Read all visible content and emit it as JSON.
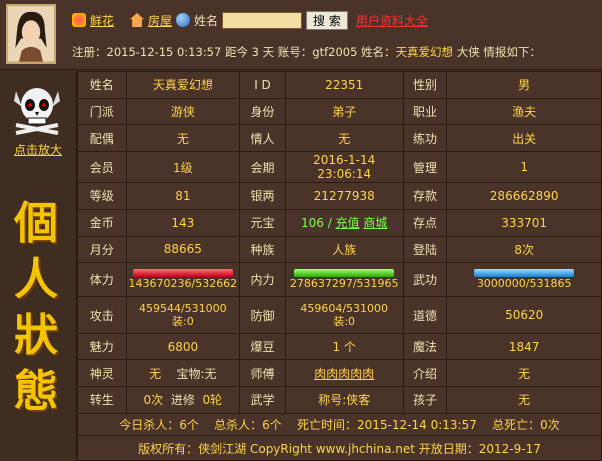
{
  "nav": {
    "fresh_label": "鲜花",
    "house_label": "房屋",
    "name_label": "姓名",
    "search_value": "",
    "search_button": "搜 索",
    "users_link": "用户资料大全"
  },
  "info_line": {
    "prefix": "注册：",
    "reg_time": "2015-12-15 0:13:57",
    "since": " 距今 3 天 账号：",
    "account": "gtf2005",
    "name_prefix": " 姓名：",
    "name": "天真爱幻想",
    "suffix": " 大侠 情报如下："
  },
  "left": {
    "zoom_link": "点击放大",
    "title_chars": [
      "個",
      "人",
      "狀",
      "態"
    ]
  },
  "rows": {
    "r1": {
      "k1": "姓名",
      "v1": "天真爱幻想",
      "k2": "I D",
      "v2": "22351",
      "k3": "性别",
      "v3": "男"
    },
    "r2": {
      "k1": "门派",
      "v1": "游侠",
      "k2": "身份",
      "v2": "弟子",
      "k3": "职业",
      "v3": "渔夫"
    },
    "r3": {
      "k1": "配偶",
      "v1": "无",
      "k2": "情人",
      "v2": "无",
      "k3": "练功",
      "v3": "出关"
    },
    "r4": {
      "k1": "会员",
      "v1": "1级",
      "k2": "会期",
      "v2": "2016-1-14 23:06:14",
      "k3": "管理",
      "v3": "1"
    },
    "r5": {
      "k1": "等级",
      "v1": "81",
      "k2": "银两",
      "v2": "21277938",
      "k3": "存款",
      "v3": "286662890"
    },
    "r6": {
      "k1": "金币",
      "v1": "143",
      "k2": "元宝",
      "v2a": "106 /",
      "v2b": "充值",
      "v2c": "商城",
      "k3": "存点",
      "v3": "333701"
    },
    "r7": {
      "k1": "月分",
      "v1": "88665",
      "k2": "种族",
      "v2": "人族",
      "k3": "登陆",
      "v3": "8次"
    },
    "r8": {
      "k1": "体力",
      "v1": "143670236/532662",
      "k2": "内力",
      "v2": "278637297/531965",
      "k3": "武功",
      "v3": "3000000/531865"
    },
    "r9": {
      "k1": "攻击",
      "v1a": "459544/531000",
      "v1b": "装:0",
      "k2": "防御",
      "v2a": "459604/531000",
      "v2b": "装:0",
      "k3": "道德",
      "v3": "50620"
    },
    "r10": {
      "k1": "魅力",
      "v1": "6800",
      "k2": "爆豆",
      "v2": "1 个",
      "k3": "魔法",
      "v3": "1847"
    },
    "r11": {
      "k1": "神灵",
      "v1a": "无",
      "v1b": "宝物:无",
      "k2": "师傅",
      "v2": "肉肉肉肉肉",
      "k3": "介绍",
      "v3": "无"
    },
    "r12": {
      "k1": "转生",
      "v1a": "0次",
      "v1b": "进修",
      "v1c": "0轮",
      "k2": "武学",
      "v2": "称号:侠客",
      "k3": "孩子",
      "v3": "无"
    }
  },
  "footer": {
    "line1": "今日杀人：6个    总杀人：6个    死亡时间：2015-12-14 0:13:57    总死亡：0次",
    "line2": "版权所有：侠剑江湖 CopyRight www.jhchina.net   开放日期：2012-9-17"
  },
  "bar_fill": {
    "hp": 1.0,
    "mp": 1.0,
    "skill": 1.0
  },
  "colors": {
    "bg": "#3f2d22",
    "accent": "#ffd34a",
    "link_red": "#ff3030",
    "link_green": "#7cff4a",
    "title_gold": "#f5c400"
  }
}
